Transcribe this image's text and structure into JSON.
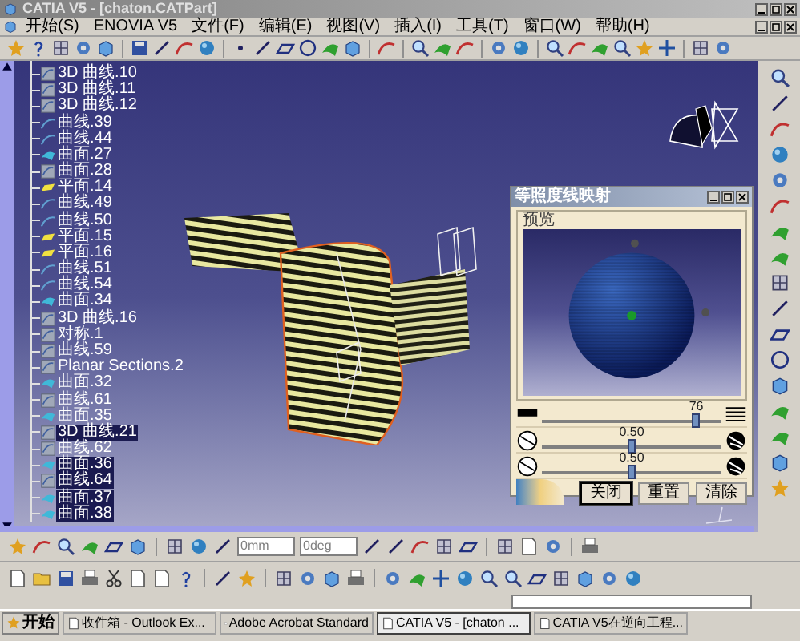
{
  "window": {
    "title": "CATIA V5 - [chaton.CATPart]"
  },
  "menu": [
    "开始(S)",
    "ENOVIA V5",
    "文件(F)",
    "编辑(E)",
    "视图(V)",
    "插入(I)",
    "工具(T)",
    "窗口(W)",
    "帮助(H)"
  ],
  "tree": {
    "items": [
      {
        "label": "3D 曲线.10",
        "kind": "curve3d",
        "selected": false
      },
      {
        "label": "3D 曲线.11",
        "kind": "curve3d",
        "selected": false
      },
      {
        "label": "3D 曲线.12",
        "kind": "curve3d",
        "selected": false
      },
      {
        "label": "曲线.39",
        "kind": "curve",
        "selected": false
      },
      {
        "label": "曲线.44",
        "kind": "curve",
        "selected": false
      },
      {
        "label": "曲面.27",
        "kind": "surface",
        "selected": false
      },
      {
        "label": "曲面.28",
        "kind": "curve3d",
        "selected": false
      },
      {
        "label": "平面.14",
        "kind": "plane",
        "selected": false
      },
      {
        "label": "曲线.49",
        "kind": "curve",
        "selected": false
      },
      {
        "label": "曲线.50",
        "kind": "curve",
        "selected": false
      },
      {
        "label": "平面.15",
        "kind": "plane",
        "selected": false
      },
      {
        "label": "平面.16",
        "kind": "plane",
        "selected": false
      },
      {
        "label": "曲线.51",
        "kind": "curve",
        "selected": false
      },
      {
        "label": "曲线.54",
        "kind": "curve",
        "selected": false
      },
      {
        "label": "曲面.34",
        "kind": "surface",
        "selected": false
      },
      {
        "label": "3D 曲线.16",
        "kind": "curve3d",
        "selected": false
      },
      {
        "label": "对称.1",
        "kind": "curve3d",
        "selected": false
      },
      {
        "label": "曲线.59",
        "kind": "curve3d",
        "selected": false
      },
      {
        "label": "Planar Sections.2",
        "kind": "curve3d",
        "selected": false
      },
      {
        "label": "曲面.32",
        "kind": "surface",
        "selected": false
      },
      {
        "label": "曲线.61",
        "kind": "curve3d",
        "selected": false
      },
      {
        "label": "曲面.35",
        "kind": "surface",
        "selected": false
      },
      {
        "label": "3D 曲线.21",
        "kind": "curve3d",
        "selected": true
      },
      {
        "label": "曲线.62",
        "kind": "curve3d",
        "selected": false
      },
      {
        "label": "曲面.36",
        "kind": "surface",
        "selected": true
      },
      {
        "label": "曲线.64",
        "kind": "curve3d",
        "selected": true
      },
      {
        "label": "曲面.37",
        "kind": "surface",
        "selected": true
      },
      {
        "label": "曲面.38",
        "kind": "surface",
        "selected": true
      }
    ]
  },
  "dialog": {
    "title": "等照度线映射",
    "group": "预览",
    "sliders": [
      {
        "kind": "density",
        "reading": "76",
        "level": 0.86
      },
      {
        "kind": "contrast",
        "reading": "0.50",
        "level": 0.5
      },
      {
        "kind": "contrast",
        "reading": "0.50",
        "level": 0.5
      }
    ],
    "buttons": [
      {
        "label": "关闭",
        "selected": true
      },
      {
        "label": "重置",
        "selected": false
      },
      {
        "label": "清除",
        "selected": false
      }
    ]
  },
  "toolbar_fields": [
    "0mm",
    "0deg"
  ],
  "taskbar": {
    "start": "开始",
    "tasks": [
      {
        "label": "收件箱 - Outlook Ex...",
        "selected": false
      },
      {
        "label": "Adobe Acrobat Standard",
        "selected": false
      },
      {
        "label": "CATIA V5 - [chaton ...",
        "selected": true
      },
      {
        "label": "CATIA V5在逆向工程...",
        "selected": false
      }
    ]
  }
}
